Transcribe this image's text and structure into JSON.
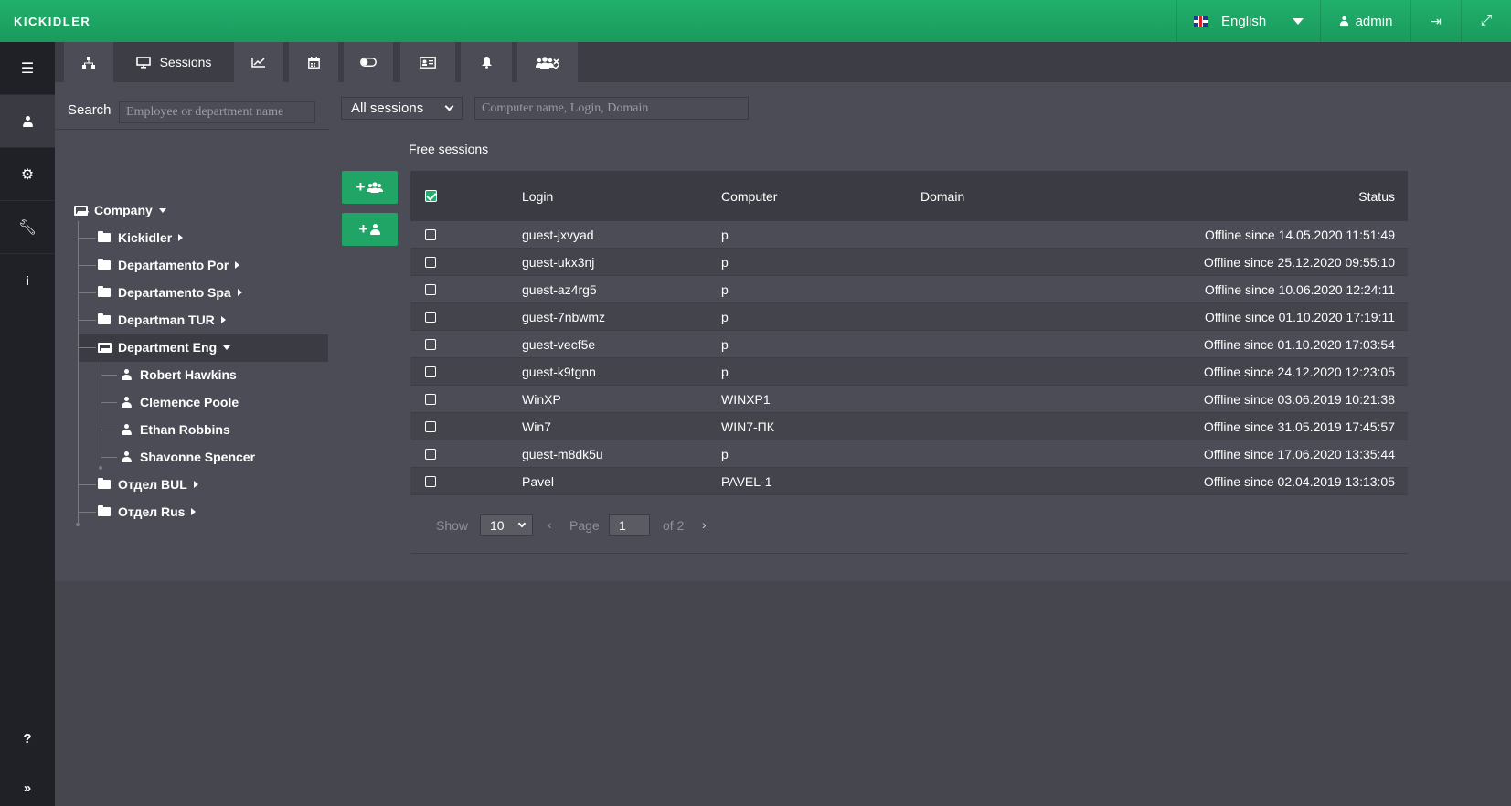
{
  "app": {
    "logo": "kickidler"
  },
  "topbar": {
    "language": "English",
    "user": "admin",
    "icons": [
      "flag-uk-icon",
      "user-icon",
      "logout-icon",
      "fullscreen-icon"
    ]
  },
  "leftnav": {
    "icons": [
      "list-icon",
      "user-icon",
      "gears-icon",
      "wrench-icon",
      "info-icon"
    ],
    "help": "?",
    "expand": "»"
  },
  "tabs": [
    {
      "icon": "sitemap-icon",
      "label": ""
    },
    {
      "icon": "desktop-icon",
      "label": "Sessions",
      "active": true
    },
    {
      "icon": "chart-icon",
      "label": ""
    },
    {
      "icon": "calendar-icon",
      "label": ""
    },
    {
      "icon": "toggle-icon",
      "label": ""
    },
    {
      "icon": "id-card-icon",
      "label": ""
    },
    {
      "icon": "bell-icon",
      "label": ""
    },
    {
      "icon": "users-remove-icon",
      "label": ""
    }
  ],
  "search": {
    "label": "Search",
    "placeholder": "Employee or department name"
  },
  "tree": {
    "root": "Company",
    "departments": [
      {
        "name": "Kickidler",
        "expanded": false
      },
      {
        "name": "Departamento Por",
        "expanded": false
      },
      {
        "name": "Departamento Spa",
        "expanded": false
      },
      {
        "name": "Departman TUR",
        "expanded": false
      },
      {
        "name": "Department Eng",
        "expanded": true,
        "employees": [
          "Robert Hawkins",
          "Clemence Poole",
          "Ethan Robbins",
          "Shavonne Spencer"
        ]
      },
      {
        "name": "Отдел BUL",
        "expanded": false
      },
      {
        "name": "Отдел Rus",
        "expanded": false
      }
    ]
  },
  "filter": {
    "session_type": "All sessions",
    "placeholder": "Computer name, Login, Domain"
  },
  "section_title": "Free sessions",
  "buttons": {
    "add_group": "+",
    "add_user": "+"
  },
  "table": {
    "headers": {
      "login": "Login",
      "computer": "Computer",
      "domain": "Domain",
      "status": "Status"
    },
    "rows": [
      {
        "login": "guest-jxvyad",
        "computer": "p",
        "domain": "",
        "status": "Offline since 14.05.2020 11:51:49"
      },
      {
        "login": "guest-ukx3nj",
        "computer": "p",
        "domain": "",
        "status": "Offline since 25.12.2020 09:55:10"
      },
      {
        "login": "guest-az4rg5",
        "computer": "p",
        "domain": "",
        "status": "Offline since 10.06.2020 12:24:11"
      },
      {
        "login": "guest-7nbwmz",
        "computer": "p",
        "domain": "",
        "status": "Offline since 01.10.2020 17:19:11"
      },
      {
        "login": "guest-vecf5e",
        "computer": "p",
        "domain": "",
        "status": "Offline since 01.10.2020 17:03:54"
      },
      {
        "login": "guest-k9tgnn",
        "computer": "p",
        "domain": "",
        "status": "Offline since 24.12.2020 12:23:05"
      },
      {
        "login": "WinXP",
        "computer": "WINXP1",
        "domain": "",
        "status": "Offline since 03.06.2019 10:21:38"
      },
      {
        "login": "Win7",
        "computer": "WIN7-ПК",
        "domain": "",
        "status": "Offline since 31.05.2019 17:45:57"
      },
      {
        "login": "guest-m8dk5u",
        "computer": "p",
        "domain": "",
        "status": "Offline since 17.06.2020 13:35:44"
      },
      {
        "login": "Pavel",
        "computer": "PAVEL-1",
        "domain": "",
        "status": "Offline since 02.04.2019 13:13:05"
      }
    ]
  },
  "pagination": {
    "show_label": "Show",
    "page_size": "10",
    "prev": "‹",
    "page_label": "Page",
    "page": "1",
    "of_label": "of 2",
    "next": "›"
  },
  "colors": {
    "accent": "#21a566",
    "topbar": "#1fa866",
    "bg": "#4b4c55",
    "nav": "#202126"
  }
}
